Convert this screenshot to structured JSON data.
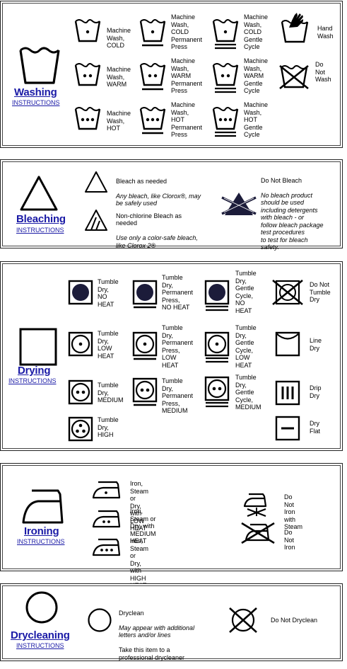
{
  "washing": {
    "title": "Washing",
    "link": "INSTRUCTIONS",
    "items": [
      {
        "label": "Machine\nWash,\nCOLD"
      },
      {
        "label": "Machine\nWash,\nCOLD\nPermanent\nPress"
      },
      {
        "label": "Machine\nWash,\nCOLD\nGentle\nCycle"
      },
      {
        "label": "Hand\nWash"
      },
      {
        "label": "Machine\nWash,\nWARM"
      },
      {
        "label": "Machine\nWash,\nWARM\nPermanent\nPress"
      },
      {
        "label": "Machine\nWash,\nWARM\nGentle\nCycle"
      },
      {
        "label": "Do\nNot\nWash"
      },
      {
        "label": "Machine\nWash,\nHOT"
      },
      {
        "label": "Machine\nWash,\nHOT\nPermanent\nPress"
      },
      {
        "label": "Machine\nWash,\nHOT\nGentle\nCycle"
      }
    ]
  },
  "bleaching": {
    "title": "Bleaching",
    "link": "INSTRUCTIONS",
    "as_needed": {
      "title": "Bleach as needed",
      "desc": "Any bleach, like Clorox®, may\nbe safely used"
    },
    "non_chlorine": {
      "title": "Non-chlorine Bleach as\nneeded",
      "desc": "Use only a color-safe bleach,\nlike Clorox 2®"
    },
    "do_not": {
      "title": "Do Not Bleach",
      "desc": "No bleach product\nshould be used\nincluding detergents\nwith bleach - or\nfollow bleach package\ntest procedures\nto test for bleach\nsafety."
    }
  },
  "drying": {
    "title": "Drying",
    "link": "INSTRUCTIONS",
    "items": [
      {
        "label": "Tumble\nDry,\nNO\nHEAT"
      },
      {
        "label": "Tumble\nDry,\nPermanent\nPress,\nNO HEAT"
      },
      {
        "label": "Tumble\nDry,\nGentle\nCycle,\nNO\nHEAT"
      },
      {
        "label": "Do Not\nTumble\nDry"
      },
      {
        "label": "Tumble\nDry,\nLOW\nHEAT"
      },
      {
        "label": "Tumble\nDry,\nPermanent\nPress,\nLOW\nHEAT"
      },
      {
        "label": "Tumble\nDry,\nGentle\nCycle,\nLOW\nHEAT"
      },
      {
        "label": "Line\nDry"
      },
      {
        "label": "Tumble\nDry,\nMEDIUM"
      },
      {
        "label": "Tumble\nDry,\nPermanent\nPress,\nMEDIUM"
      },
      {
        "label": "Tumble\nDry,\nGentle\nCycle,\nMEDIUM"
      },
      {
        "label": "Drip\nDry"
      },
      {
        "label": "Tumble\nDry,\nHIGH"
      },
      {
        "label": "Dry\nFlat"
      }
    ]
  },
  "ironing": {
    "title": "Ironing",
    "link": "INSTRUCTIONS",
    "items": [
      {
        "label": "Iron, Steam or Dry, with\nLOW HEAT"
      },
      {
        "label": "Iron, Steam or Dry, with\nMEDIUM HEAT"
      },
      {
        "label": "Iron, Steam or Dry, with\nHIGH HEAT"
      },
      {
        "label": "Do Not Iron\nwith Steam"
      },
      {
        "label": "Do Not Iron"
      }
    ]
  },
  "drycleaning": {
    "title": "Drycleaning",
    "link": "INSTRUCTIONS",
    "dryclean": {
      "title": "Dryclean",
      "desc": "May appear with additional\nletters and/or lines",
      "note": "Take this item to a\nprofessional drycleaner"
    },
    "do_not": {
      "label": "Do Not Dryclean"
    }
  }
}
